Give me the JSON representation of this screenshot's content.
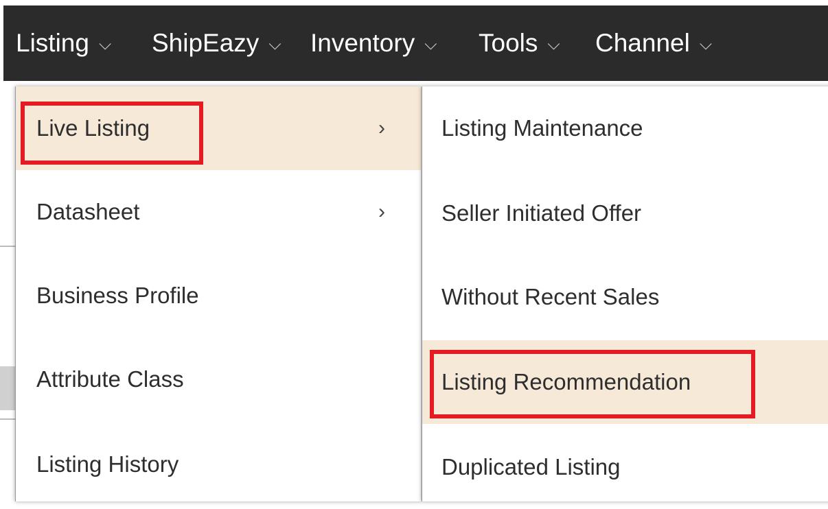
{
  "topnav": {
    "items": [
      {
        "label": "Listing"
      },
      {
        "label": "ShipEazy"
      },
      {
        "label": "Inventory"
      },
      {
        "label": "Tools"
      },
      {
        "label": "Channel"
      }
    ],
    "chevron_icon": "chevron-down-icon"
  },
  "left_menu": {
    "items": [
      {
        "label": "Live Listing",
        "has_submenu": true,
        "active": true
      },
      {
        "label": "Datasheet",
        "has_submenu": true
      },
      {
        "label": "Business Profile"
      },
      {
        "label": "Attribute Class"
      },
      {
        "label": "Listing History"
      }
    ],
    "submenu_arrow": "›"
  },
  "right_menu": {
    "items": [
      {
        "label": "Listing Maintenance"
      },
      {
        "label": "Seller Initiated Offer"
      },
      {
        "label": "Without Recent Sales"
      },
      {
        "label": "Listing Recommendation",
        "active": true
      },
      {
        "label": "Duplicated Listing"
      }
    ]
  },
  "colors": {
    "topbar": "#2b2b2b",
    "active_item": "#f7e9d8",
    "highlight": "#e51b24"
  }
}
